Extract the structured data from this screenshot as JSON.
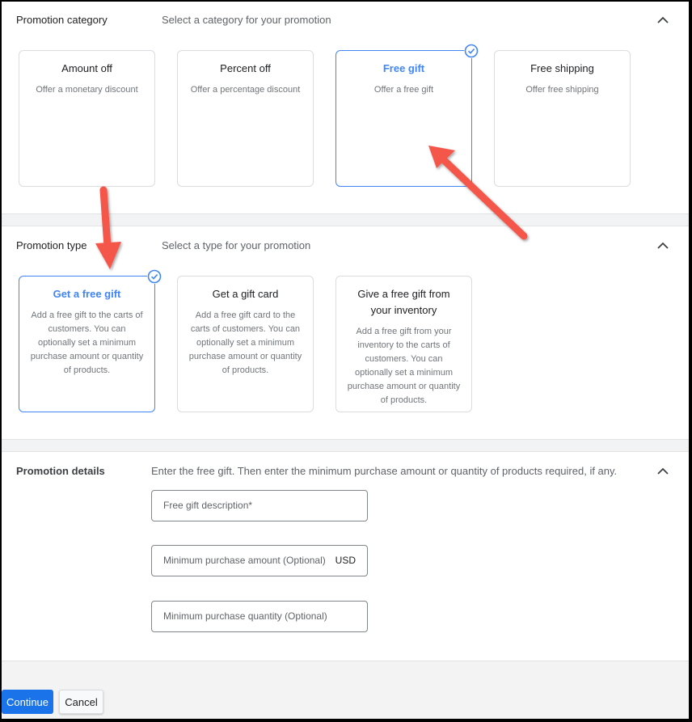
{
  "category": {
    "title": "Promotion category",
    "subtitle": "Select a category for your promotion",
    "collapse_icon": "chevron-up-icon",
    "cards": [
      {
        "title": "Amount off",
        "desc": "Offer a monetary discount",
        "selected": false
      },
      {
        "title": "Percent off",
        "desc": "Offer a percentage discount",
        "selected": false
      },
      {
        "title": "Free gift",
        "desc": "Offer a free gift",
        "selected": true
      },
      {
        "title": "Free shipping",
        "desc": "Offer free shipping",
        "selected": false
      }
    ]
  },
  "type": {
    "title": "Promotion type",
    "subtitle": "Select a type for your promotion",
    "collapse_icon": "chevron-up-icon",
    "cards": [
      {
        "title": "Get a free gift",
        "desc": "Add a free gift to the carts of customers. You can optionally set a minimum purchase amount or quantity of products.",
        "selected": true
      },
      {
        "title": "Get a gift card",
        "desc": "Add a free gift card to the carts of customers. You can optionally set a minimum purchase amount or quantity of products.",
        "selected": false
      },
      {
        "title": "Give a free gift from your inventory",
        "desc": "Add a free gift from your inventory to the carts of customers. You can optionally set a minimum purchase amount or quantity of products.",
        "selected": false
      }
    ]
  },
  "details": {
    "title": "Promotion details",
    "subtitle": "Enter the free gift. Then enter the minimum purchase amount or quantity of products required, if any.",
    "collapse_icon": "chevron-up-icon",
    "fields": [
      {
        "placeholder": "Free gift description*",
        "value": "",
        "suffix": ""
      },
      {
        "placeholder": "Minimum purchase amount (Optional)",
        "value": "",
        "suffix": "USD"
      },
      {
        "placeholder": "Minimum purchase quantity (Optional)",
        "value": "",
        "suffix": ""
      }
    ]
  },
  "footer": {
    "continue_label": "Continue",
    "cancel_label": "Cancel"
  },
  "colors": {
    "accent": "#4285f4",
    "primary_button": "#1a73e8",
    "annotation_arrow": "#f4574a"
  },
  "annotations": [
    {
      "icon": "red-arrow-icon",
      "points_to": "Free gift"
    },
    {
      "icon": "red-arrow-icon",
      "points_to": "Get a free gift"
    }
  ]
}
